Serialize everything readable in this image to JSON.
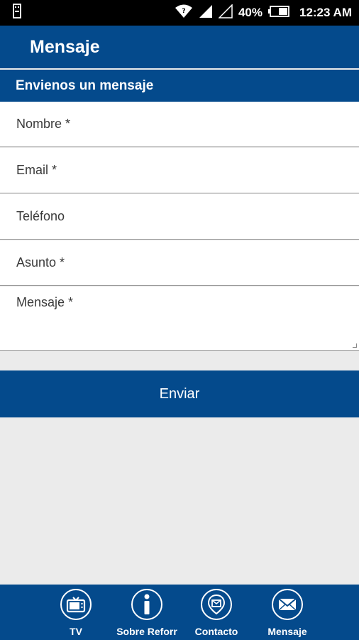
{
  "status_bar": {
    "battery_percent": "40%",
    "time": "12:23 AM",
    "icons": [
      "usb-icon",
      "wifi-icon",
      "signal-icon",
      "signal-empty-icon",
      "battery-icon"
    ]
  },
  "app_bar": {
    "title": "Mensaje"
  },
  "section": {
    "title": "Envienos un mensaje"
  },
  "form": {
    "name_placeholder": "Nombre *",
    "email_placeholder": "Email *",
    "phone_placeholder": "Teléfono",
    "subject_placeholder": "Asunto *",
    "message_placeholder": "Mensaje *",
    "submit_label": "Enviar"
  },
  "bottom_nav": {
    "items": [
      {
        "label": "TV",
        "icon": "tv-icon"
      },
      {
        "label": "Sobre Reforr",
        "icon": "info-icon"
      },
      {
        "label": "Contacto",
        "icon": "contact-icon"
      },
      {
        "label": "Mensaje",
        "icon": "mail-icon"
      }
    ]
  },
  "colors": {
    "primary": "#044a8c",
    "background": "#ebebeb",
    "status_bar": "#000000"
  }
}
